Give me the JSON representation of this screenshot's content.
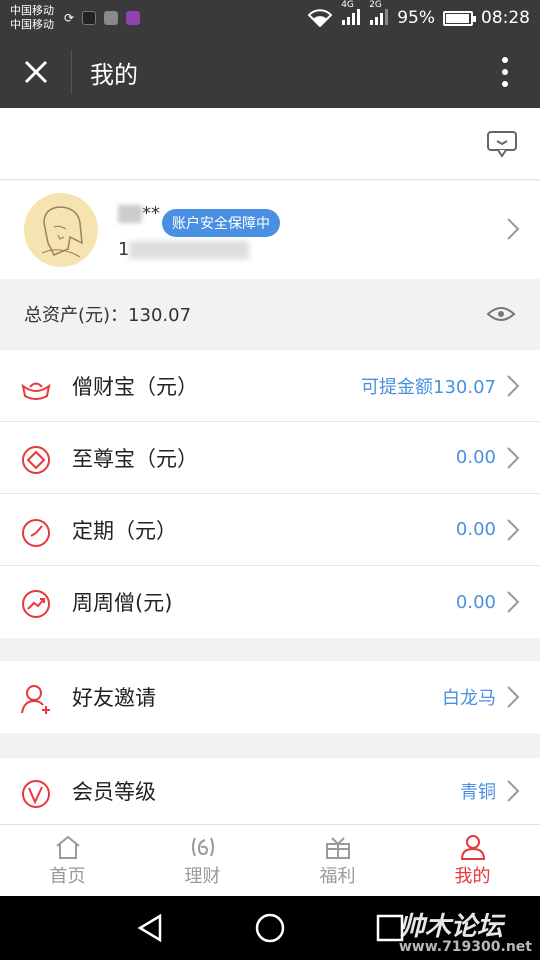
{
  "status_bar": {
    "carrier_1": "中国移动",
    "carrier_2": "中国移动",
    "network_1": "4G",
    "network_2": "2G",
    "battery": "95%",
    "battery_level": 0.95,
    "time": "08:28"
  },
  "header": {
    "title": "我的"
  },
  "profile": {
    "name_suffix": "**",
    "security_badge": "账户安全保障中",
    "phone_prefix": "1"
  },
  "assets": {
    "label": "总资产(元)：130.07"
  },
  "products": [
    {
      "label": "僧财宝（元）",
      "value": "可提金额130.07",
      "icon": "ingot-icon"
    },
    {
      "label": "至尊宝（元）",
      "value": "0.00",
      "icon": "diamond-icon"
    },
    {
      "label": "定期（元）",
      "value": "0.00",
      "icon": "clock-icon"
    },
    {
      "label": "周周僧(元)",
      "value": "0.00",
      "icon": "trend-icon"
    }
  ],
  "social": [
    {
      "label": "好友邀请",
      "value": "白龙马",
      "icon": "add-friend-icon"
    }
  ],
  "membership": [
    {
      "label": "会员等级",
      "value": "青铜",
      "icon": "vip-icon"
    }
  ],
  "tabs": [
    {
      "label": "首页",
      "icon": "home-icon",
      "active": false
    },
    {
      "label": "理财",
      "icon": "finance-icon",
      "active": false
    },
    {
      "label": "福利",
      "icon": "gift-icon",
      "active": false
    },
    {
      "label": "我的",
      "icon": "user-icon",
      "active": true
    }
  ],
  "watermark": {
    "title": "帅木论坛",
    "url": "www.719300.net"
  },
  "colors": {
    "accent_red": "#e8383d",
    "link_blue": "#4a90e2",
    "header_bg": "#3a3a3c"
  }
}
